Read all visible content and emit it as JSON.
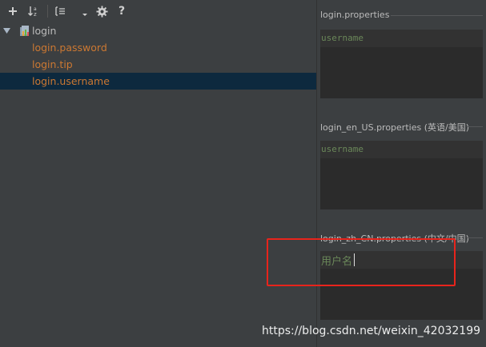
{
  "toolbar": {
    "buttons": [
      {
        "name": "add-property-button",
        "icon": "plus-icon"
      },
      {
        "name": "sort-alphabetically-button",
        "icon": "sort-az-icon"
      },
      {
        "name": "group-by-prefix-button",
        "icon": "group-icon"
      },
      {
        "name": "dropdown-button",
        "icon": "chevron-down-icon"
      },
      {
        "name": "settings-button",
        "icon": "gear-icon"
      },
      {
        "name": "help-button",
        "icon": "question-icon"
      }
    ]
  },
  "tree": {
    "root": {
      "label": "login",
      "icon": "resource-bundle-icon",
      "expanded": true
    },
    "keys": [
      {
        "label": "login.password",
        "selected": false
      },
      {
        "label": "login.tip",
        "selected": false
      },
      {
        "label": "login.username",
        "selected": true
      }
    ]
  },
  "editors": [
    {
      "title": "login.properties",
      "value": "username"
    },
    {
      "title": "login_en_US.properties (英语/美国)",
      "value": "username"
    },
    {
      "title": "login_zh_CN.properties (中文/中国)",
      "value": "用户名"
    }
  ],
  "watermark": "https://blog.csdn.net/weixin_42032199",
  "colors": {
    "background": "#3c3f41",
    "editor_background": "#2b2b2b",
    "key_color": "#cc7832",
    "value_color": "#6a8759",
    "selection": "#0d293e",
    "annotation": "#e8241c"
  }
}
